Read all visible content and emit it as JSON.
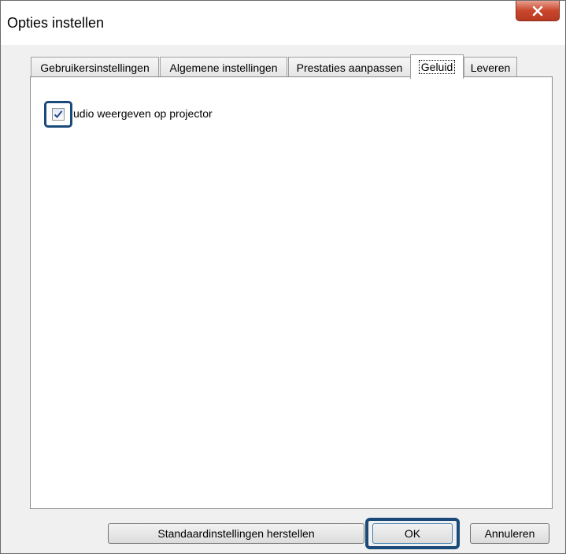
{
  "window": {
    "title": "Opties instellen"
  },
  "titlebar": {
    "close_icon": "close-x-icon"
  },
  "tabs": [
    {
      "label": "Gebruikersinstellingen",
      "active": false
    },
    {
      "label": "Algemene instellingen",
      "active": false
    },
    {
      "label": "Prestaties aanpassen",
      "active": false
    },
    {
      "label": "Geluid",
      "active": true
    },
    {
      "label": "Leveren",
      "active": false
    }
  ],
  "sound_panel": {
    "audio_checkbox": {
      "label": "udio weergeven op projector",
      "checked": true
    }
  },
  "buttons": {
    "restore_defaults": "Standaardinstellingen herstellen",
    "ok": "OK",
    "cancel": "Annuleren"
  },
  "colors": {
    "highlight": "#1a4a7a",
    "close_button": "#c9462c"
  }
}
